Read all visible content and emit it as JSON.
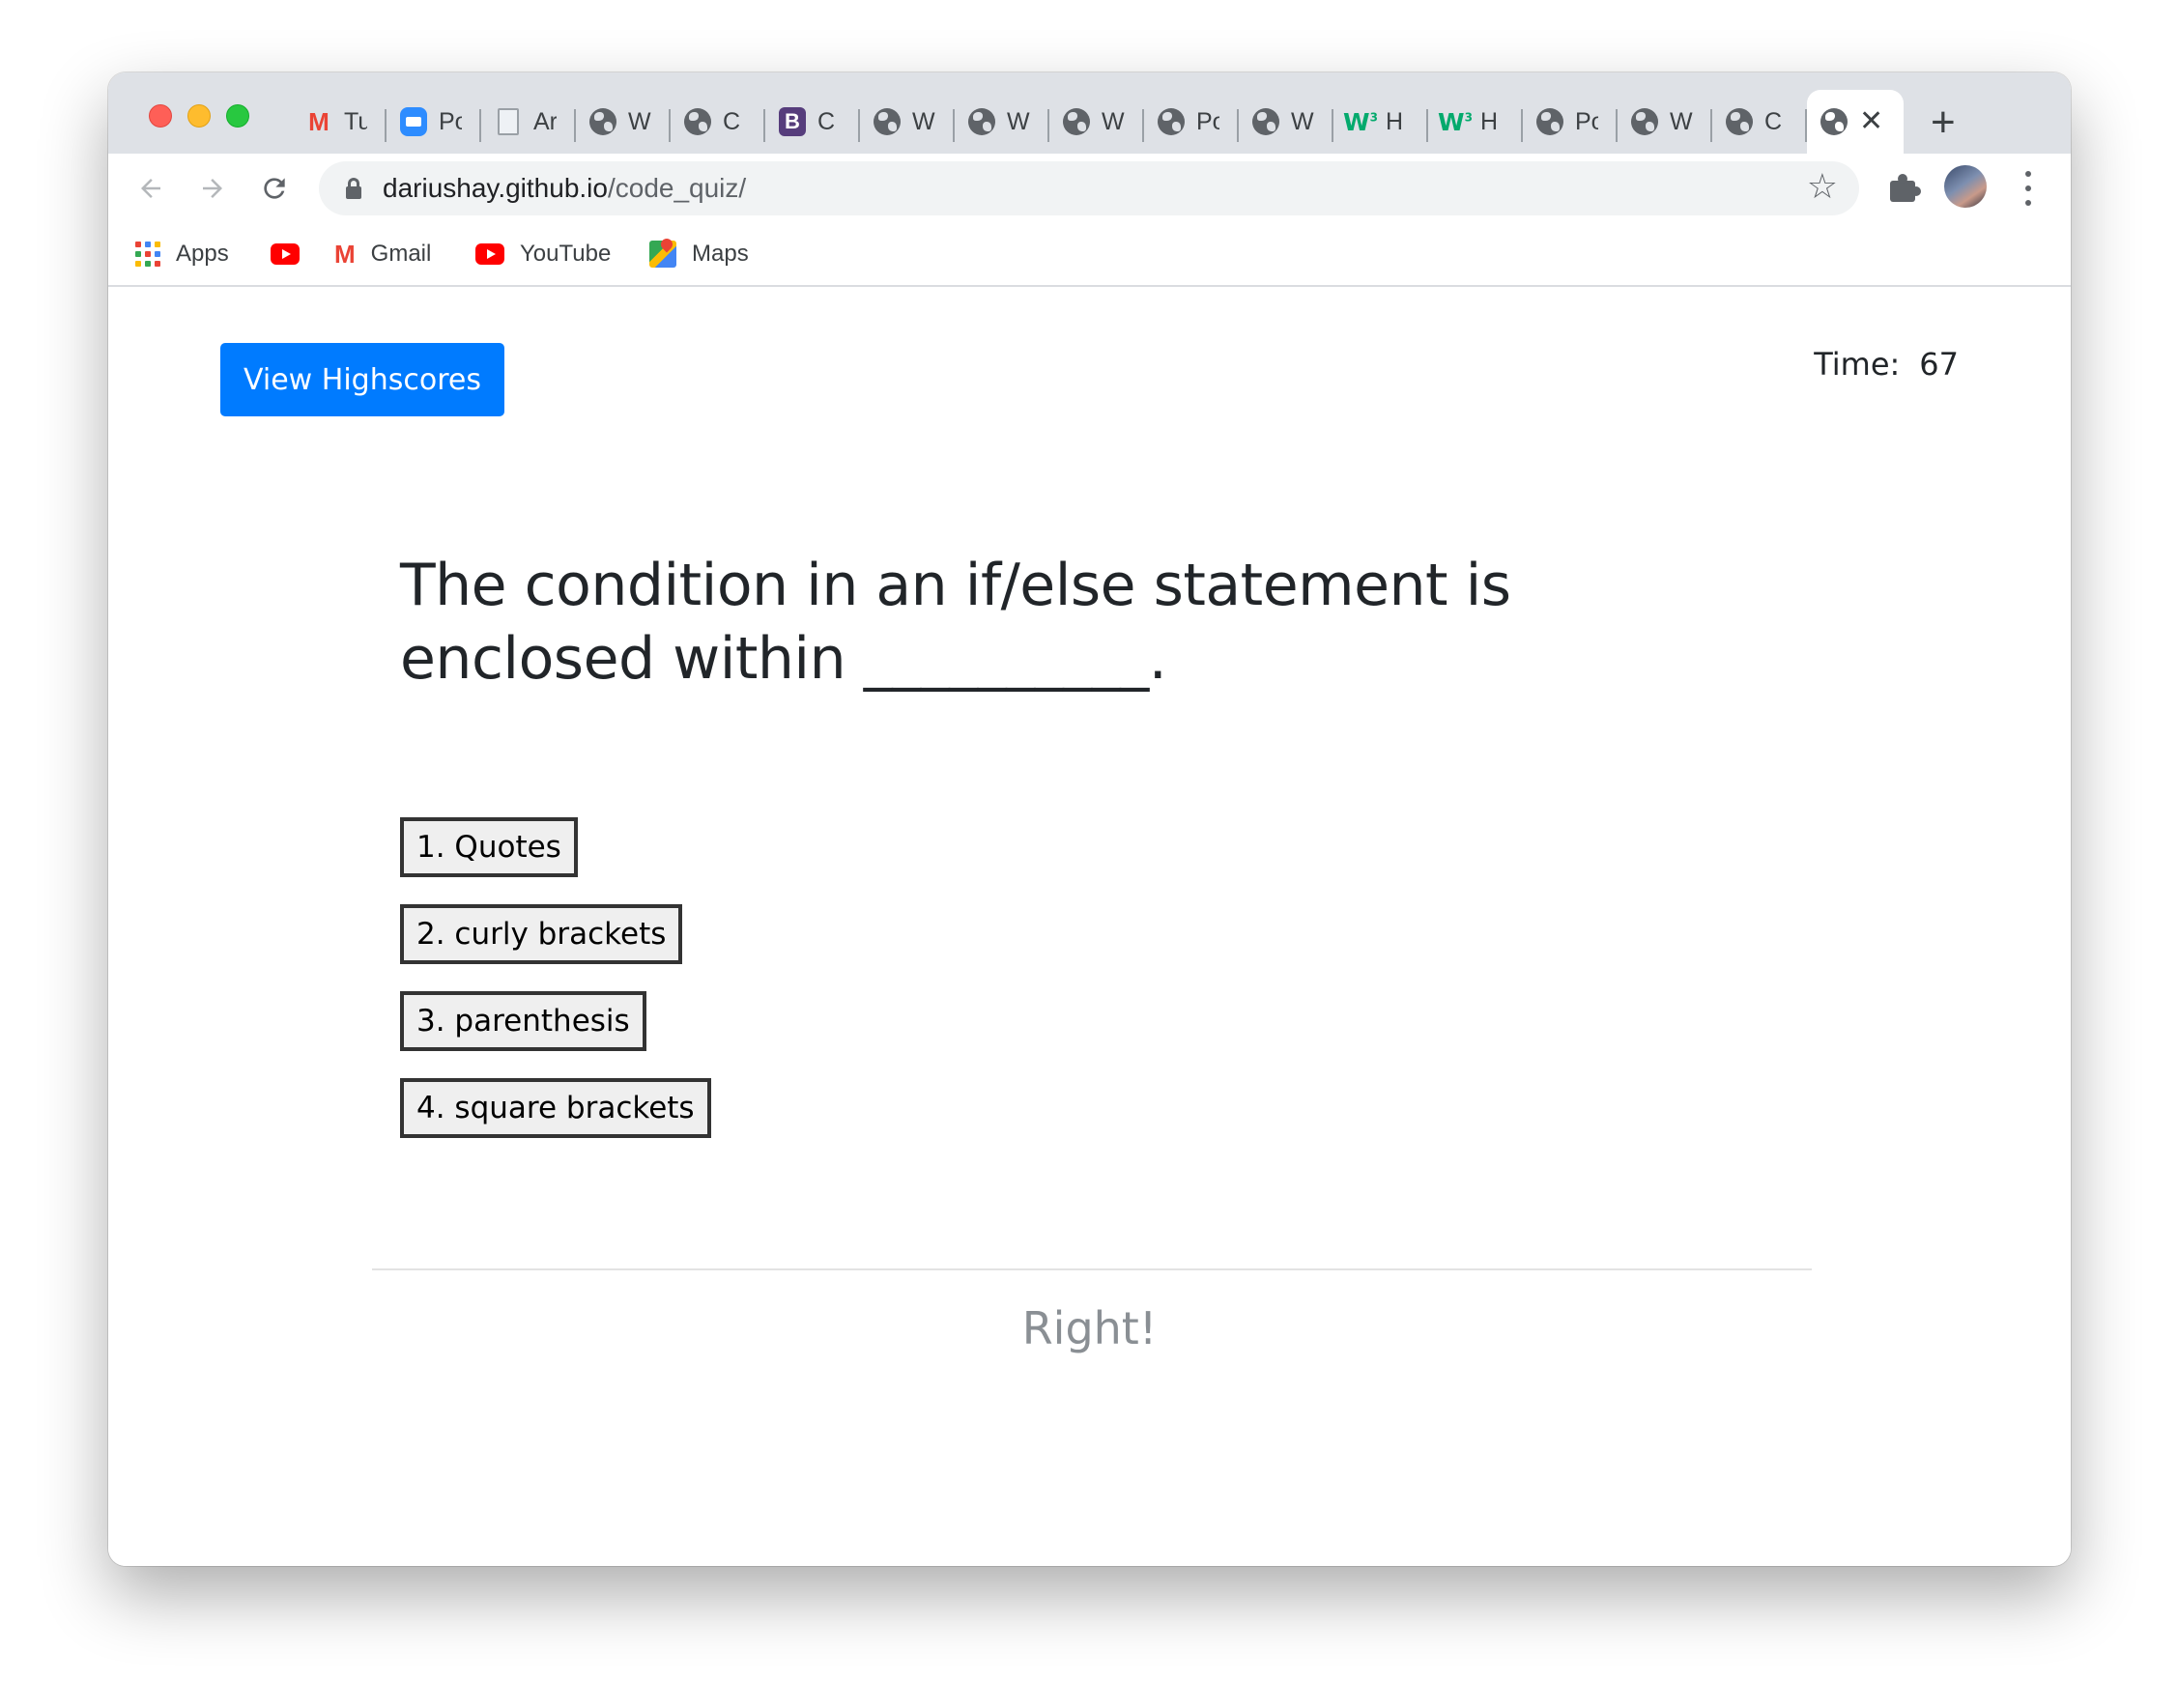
{
  "browser": {
    "tabs": [
      {
        "icon": "gmail-icon",
        "title": "Tu"
      },
      {
        "icon": "zoom-icon",
        "title": "Po"
      },
      {
        "icon": "document-icon",
        "title": "Ar"
      },
      {
        "icon": "globe-icon",
        "title": "W"
      },
      {
        "icon": "globe-icon",
        "title": "C"
      },
      {
        "icon": "bootstrap-icon",
        "title": "C"
      },
      {
        "icon": "globe-icon",
        "title": "W"
      },
      {
        "icon": "globe-icon",
        "title": "W"
      },
      {
        "icon": "globe-icon",
        "title": "W"
      },
      {
        "icon": "globe-icon",
        "title": "Po"
      },
      {
        "icon": "globe-icon",
        "title": "W"
      },
      {
        "icon": "w3schools-icon",
        "title": "H"
      },
      {
        "icon": "w3schools-icon",
        "title": "H"
      },
      {
        "icon": "globe-icon",
        "title": "Po"
      },
      {
        "icon": "globe-icon",
        "title": "W"
      },
      {
        "icon": "globe-icon",
        "title": "C"
      }
    ],
    "active_tab": {
      "icon": "globe-icon",
      "close": "✕"
    },
    "new_tab": "+",
    "url": {
      "domain": "dariushay.github.io",
      "path": "/code_quiz/"
    },
    "bookmarks": {
      "apps": "Apps",
      "gmail": "Gmail",
      "youtube": "YouTube",
      "maps": "Maps"
    }
  },
  "quiz": {
    "highscores_button": "View Highscores",
    "time_label": "Time:",
    "time_value": "67",
    "question": "The condition in an if/else statement is enclosed within __________.",
    "choices": [
      "1. Quotes",
      "2. curly brackets",
      "3. parenthesis",
      "4. square brackets"
    ],
    "feedback": "Right!"
  },
  "colors": {
    "primary_button": "#007bff",
    "feedback_text": "#8a8f94"
  }
}
